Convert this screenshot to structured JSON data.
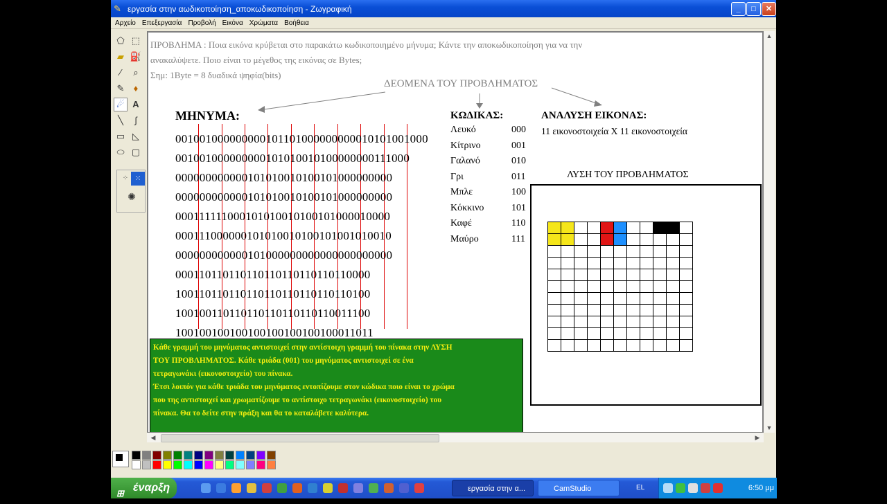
{
  "window": {
    "title": "εργασία στην αωδικοποίηση_αποκωδικοποίηση - Ζωγραφική"
  },
  "menu": [
    "Αρχείο",
    "Επεξεργασία",
    "Προβολή",
    "Εικόνα",
    "Χρώματα",
    "Βοήθεια"
  ],
  "problem": {
    "line1": "ΠΡΟΒΛΗΜΑ : Ποια εικόνα κρύβεται στο παρακάτω κωδικοποιημένο μήνυμα; Κάντε την αποκωδικοποίηση για να την",
    "line2": "ανακαλύψετε.    Ποιο είναι το μέγεθος της εικόνας σε Bytes;",
    "line3": "Σημ: 1Byte = 8 δυαδικά ψηφία(bits)"
  },
  "data_heading": "ΔΕΟΜΕΝΑ ΤΟΥ ΠΡΟΒΛΗΜΑΤΟΣ",
  "message": {
    "label": "ΜΗΝΥΜΑ:",
    "rows": [
      "001001000000000101101000000000010101001000",
      "001001000000000101010010100000000111000",
      "000000000000101010010100101000000000",
      "000000000000101010010100101000000000",
      "000111111000101010010100101000010000",
      "000111000000101010010100101001010010",
      "000000000000101000000000000000000000",
      "000110110110110110110110110110000",
      "100110110110110110110110110110100",
      "100100110110110110110110110011100",
      "100100100100100100100100100011011"
    ]
  },
  "codes": {
    "label": "ΚΩΔΙΚΑΣ:",
    "items": [
      {
        "name": "Λευκό",
        "code": "000"
      },
      {
        "name": "Κίτρινο",
        "code": "001"
      },
      {
        "name": "Γαλανό",
        "code": "010"
      },
      {
        "name": "Γρι",
        "code": "011"
      },
      {
        "name": "Μπλε",
        "code": "100"
      },
      {
        "name": "Κόκκινο",
        "code": "101"
      },
      {
        "name": "Καφέ",
        "code": "110"
      },
      {
        "name": "Μαύρο",
        "code": "111"
      }
    ]
  },
  "image_analysis": {
    "label": "ΑΝΑΛΥΣΗ ΕΙΚΟΝΑΣ:",
    "text": "11 εικονοστοιχεία Χ 11 εικονοστοιχεία"
  },
  "solution": {
    "title": "ΛΥΣΗ ΤΟΥ ΠΡΟΒΛΗΜΑΤΟΣ",
    "grid_size": 11,
    "filled": [
      {
        "row": 0,
        "col": 0,
        "color": "#f5e61a"
      },
      {
        "row": 0,
        "col": 1,
        "color": "#f5e61a"
      },
      {
        "row": 1,
        "col": 0,
        "color": "#f5e61a"
      },
      {
        "row": 1,
        "col": 1,
        "color": "#f5e61a"
      },
      {
        "row": 0,
        "col": 4,
        "color": "#e01515"
      },
      {
        "row": 1,
        "col": 4,
        "color": "#e01515"
      },
      {
        "row": 0,
        "col": 5,
        "color": "#1e90ff"
      },
      {
        "row": 1,
        "col": 5,
        "color": "#1e90ff"
      },
      {
        "row": 0,
        "col": 8,
        "color": "#000000"
      },
      {
        "row": 0,
        "col": 9,
        "color": "#000000"
      }
    ]
  },
  "instructions": [
    "Κάθε γραμμή του μηνύματος αντιστοιχεί στην αντίστοιχη γραμμή του πίνακα στην ΛΥΣΗ",
    "ΤΟΥ ΠΡΟΒΛΗΜΑΤΟΣ. Κάθε τριάδα (001) του μηνύματος αντιστοιχεί σε ένα",
    "τετραγωνάκι (εικονοστοιχείο) του πίνακα.",
    "Έτσι λοιπόν για κάθε τριάδα του μηνύματος εντοπίζουμε στον κώδικα ποιο είναι το χρώμα",
    "που της αντιστοιχεί και χρωματίζουμε το αντίστοιχο τετραγωνάκι (εικονοστοιχείο) του",
    "πίνακα. Θα το δείτε στην πράξη και θα το καταλάβετε καλύτερα."
  ],
  "palette": [
    "#000000",
    "#808080",
    "#800000",
    "#808000",
    "#008000",
    "#008080",
    "#000080",
    "#800080",
    "#808040",
    "#004040",
    "#0080ff",
    "#004080",
    "#8000ff",
    "#804000",
    "#ffffff",
    "#c0c0c0",
    "#ff0000",
    "#ffff00",
    "#00ff00",
    "#00ffff",
    "#0000ff",
    "#ff00ff",
    "#ffff80",
    "#00ff80",
    "#80ffff",
    "#8080ff",
    "#ff0080",
    "#ff8040"
  ],
  "taskbar": {
    "start": "έναρξη",
    "tasks": [
      "εργασία στην α...",
      "CamStudio"
    ],
    "lang": "EL",
    "clock": "6:50 μμ"
  }
}
